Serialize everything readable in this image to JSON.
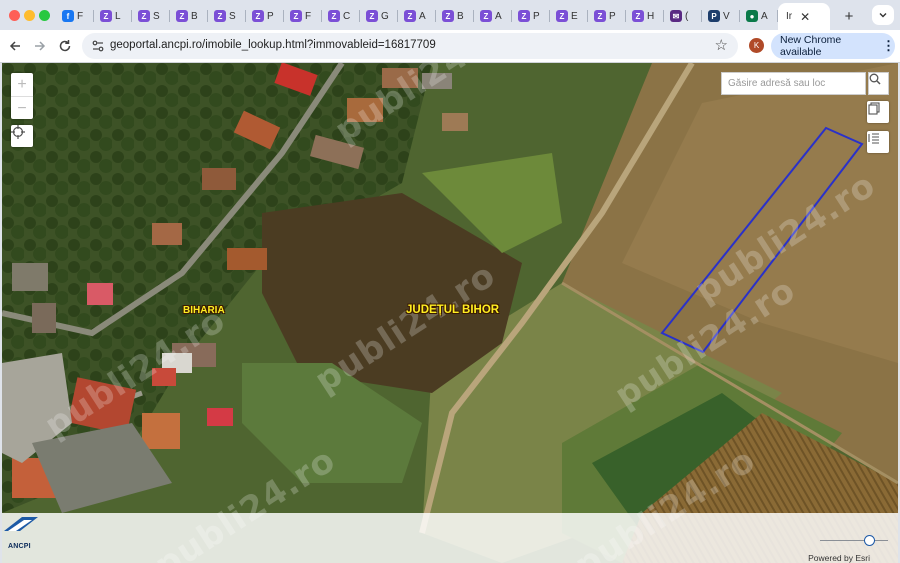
{
  "browser": {
    "tabs": [
      {
        "letter": "F",
        "icon": "facebook-icon",
        "color": "#1877f2"
      },
      {
        "letter": "L",
        "icon": "publi24-icon",
        "color": "#7b4fd6"
      },
      {
        "letter": "S",
        "icon": "publi24-icon",
        "color": "#7b4fd6"
      },
      {
        "letter": "B",
        "icon": "publi24-icon",
        "color": "#7b4fd6"
      },
      {
        "letter": "S",
        "icon": "publi24-icon",
        "color": "#7b4fd6"
      },
      {
        "letter": "P",
        "icon": "publi24-icon",
        "color": "#7b4fd6"
      },
      {
        "letter": "F",
        "icon": "publi24-icon",
        "color": "#7b4fd6"
      },
      {
        "letter": "C",
        "icon": "publi24-icon",
        "color": "#7b4fd6"
      },
      {
        "letter": "G",
        "icon": "publi24-icon",
        "color": "#7b4fd6"
      },
      {
        "letter": "A",
        "icon": "publi24-icon",
        "color": "#7b4fd6"
      },
      {
        "letter": "B",
        "icon": "publi24-icon",
        "color": "#7b4fd6"
      },
      {
        "letter": "A",
        "icon": "publi24-icon",
        "color": "#7b4fd6"
      },
      {
        "letter": "P",
        "icon": "publi24-icon",
        "color": "#7b4fd6"
      },
      {
        "letter": "E",
        "icon": "publi24-icon",
        "color": "#7b4fd6"
      },
      {
        "letter": "P",
        "icon": "publi24-icon",
        "color": "#7b4fd6"
      },
      {
        "letter": "H",
        "icon": "publi24-icon",
        "color": "#7b4fd6"
      },
      {
        "letter": "(",
        "icon": "mail-icon",
        "color": "#5a2a83"
      },
      {
        "letter": "V",
        "icon": "parking-icon",
        "color": "#1d3d6b"
      },
      {
        "letter": "A",
        "icon": "ancpi-dot-icon",
        "color": "#0b7a4a"
      }
    ],
    "active_tab": {
      "label": "Ir"
    },
    "url": "geoportal.ancpi.ro/imobile_lookup.html?immovableid=16817709",
    "profile_initial": "K",
    "update_label": "New Chrome available"
  },
  "map": {
    "zoom_in": "+",
    "zoom_out": "−",
    "search_placeholder": "Găsire adresă sau loc",
    "labels": {
      "locality": "BIHARIA",
      "county": "JUDEȚUL BIHOR"
    },
    "attribution": "Powered by Esri",
    "logo_text": "ANCPI",
    "watermark": "publi24.ro",
    "parcel_color": "#2a31c9"
  }
}
